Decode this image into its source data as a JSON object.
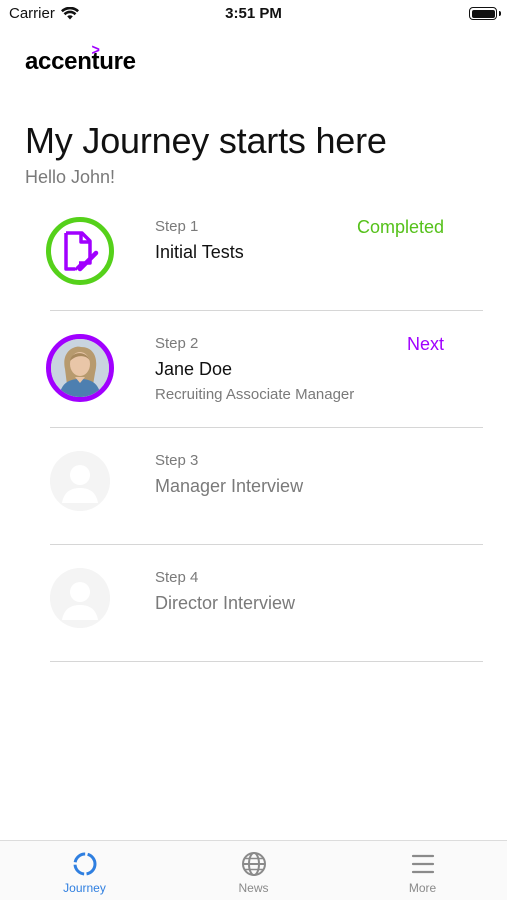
{
  "status_bar": {
    "carrier": "Carrier",
    "time": "3:51 PM"
  },
  "brand": {
    "logo_text": "accenture",
    "logo_mark": ">",
    "accent": "#a100ff"
  },
  "header": {
    "title": "My Journey starts here",
    "greeting": "Hello John!"
  },
  "steps": [
    {
      "step": "Step 1",
      "title": "Initial Tests",
      "subtitle": "",
      "status": "Completed",
      "avatar": "document-edit-icon",
      "status_color": "#55c11a"
    },
    {
      "step": "Step 2",
      "title": "Jane Doe",
      "subtitle": "Recruiting Associate Manager",
      "status": "Next",
      "avatar": "person-photo",
      "status_color": "#a100ff"
    },
    {
      "step": "Step 3",
      "title": "Manager Interview",
      "subtitle": "",
      "status": "",
      "avatar": "person-placeholder-icon"
    },
    {
      "step": "Step 4",
      "title": "Director Interview",
      "subtitle": "",
      "status": "",
      "avatar": "person-placeholder-icon"
    }
  ],
  "tab_bar": {
    "active": "Journey",
    "tabs": [
      {
        "label": "Journey",
        "icon": "circle-icon"
      },
      {
        "label": "News",
        "icon": "globe-icon"
      },
      {
        "label": "More",
        "icon": "menu-icon"
      }
    ],
    "active_color": "#2f7fe0"
  }
}
